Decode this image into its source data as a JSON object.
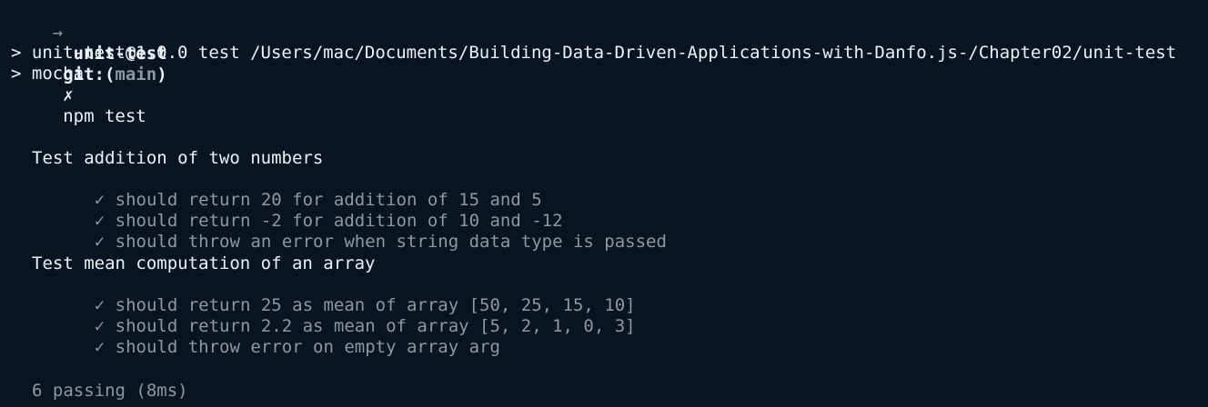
{
  "prompt": {
    "arrow": "→",
    "dir": "unit-test",
    "git_prefix": "git:(",
    "branch": "main",
    "git_suffix": ")",
    "dirty": "✗",
    "command": "npm test"
  },
  "run": {
    "script_line": "> unit-test@1.0.0 test /Users/mac/Documents/Building-Data-Driven-Applications-with-Danfo.js-/Chapter02/unit-test",
    "mocha_line": "> mocha"
  },
  "suites": [
    {
      "title": "Test addition of two numbers",
      "tests": [
        "should return 20 for addition of 15 and 5",
        "should return -2 for addition of 10 and -12",
        "should throw an error when string data type is passed"
      ]
    },
    {
      "title": "Test mean computation of an array",
      "tests": [
        "should return 25 as mean of array [50, 25, 15, 10]",
        "should return 2.2 as mean of array [5, 2, 1, 0, 3]",
        "should throw error on empty array arg"
      ]
    }
  ],
  "check_mark": "✓",
  "summary": "6 passing (8ms)"
}
